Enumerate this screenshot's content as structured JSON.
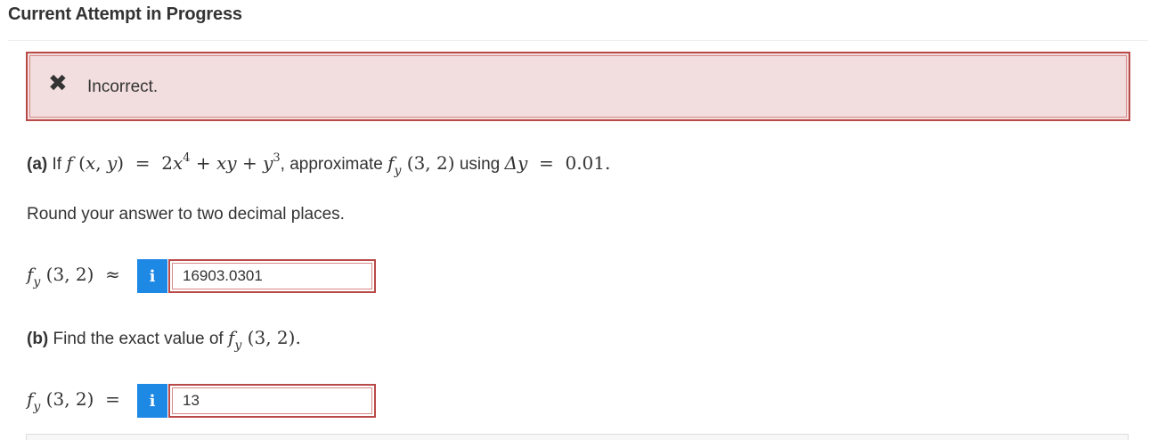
{
  "header": {
    "title": "Current Attempt in Progress"
  },
  "alert": {
    "icon": "x-mark-icon",
    "icon_glyph": "✖",
    "message": "Incorrect.",
    "bg": "#f2dede",
    "border": "#b94a48"
  },
  "part_a": {
    "label": "(a)",
    "text_if": "If",
    "text_approx": ", approximate",
    "text_using": "using",
    "round_note": "Round your answer to two decimal places.",
    "answer_value": "16903.0301"
  },
  "part_b": {
    "label": "(b)",
    "text": "Find the exact value of",
    "answer_value": "13"
  },
  "info_button": {
    "glyph": "i",
    "color": "#1e88e5"
  }
}
